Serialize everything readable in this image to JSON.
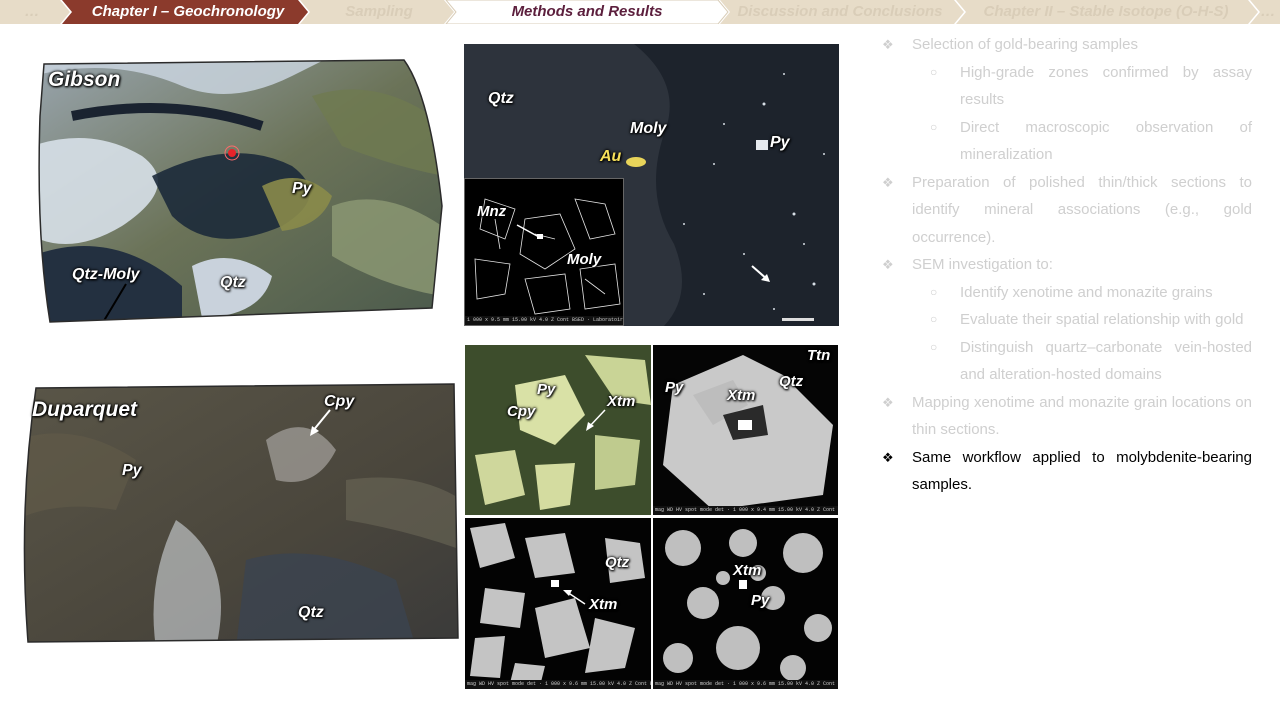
{
  "nav": {
    "items": [
      {
        "label": "…",
        "state": "past"
      },
      {
        "label": "Chapter I – Geochronology",
        "state": "current-chapter"
      },
      {
        "label": "Sampling",
        "state": "past"
      },
      {
        "label": "Methods and Results",
        "state": "active"
      },
      {
        "label": "Discussion and Conclusions",
        "state": "upcoming"
      },
      {
        "label": "Chapter II – Stable Isotope (O-H-S)",
        "state": "upcoming"
      },
      {
        "label": "…",
        "state": "upcoming"
      }
    ],
    "colors": {
      "chapter_fill": "#8b3a2c",
      "tab_fill": "#e7dcc8",
      "active_fill": "#ffffff",
      "active_text": "#5c1f3d"
    }
  },
  "gibson": {
    "title": "Gibson",
    "labels": {
      "py": "Py",
      "qtz_moly": "Qtz-Moly",
      "qtz": "Qtz"
    }
  },
  "gibson_micro": {
    "labels": {
      "qtz": "Qtz",
      "moly": "Moly",
      "au": "Au",
      "py": "Py"
    },
    "inset_labels": {
      "mnz": "Mnz",
      "moly": "Moly"
    }
  },
  "duparquet": {
    "title": "Duparquet",
    "labels": {
      "cpy": "Cpy",
      "py": "Py",
      "qtz": "Qtz"
    }
  },
  "duparquet_micro": {
    "tl": {
      "py": "Py",
      "cpy": "Cpy",
      "xtm": "Xtm"
    },
    "tr": {
      "ttn": "Ttn",
      "py": "Py",
      "xtm": "Xtm",
      "qtz": "Qtz"
    },
    "bl": {
      "qtz": "Qtz",
      "xtm": "Xtm"
    },
    "br": {
      "xtm": "Xtm",
      "py": "Py"
    }
  },
  "bullets": {
    "items": [
      {
        "level": 1,
        "text": "Selection of gold-bearing samples",
        "active": false
      },
      {
        "level": 2,
        "text": "High-grade zones confirmed by assay results",
        "active": false
      },
      {
        "level": 2,
        "text": "Direct macroscopic observation of mineralization",
        "active": false
      },
      {
        "level": 1,
        "text": "Preparation of polished thin/thick sections to identify mineral associations (e.g., gold occurrence).",
        "active": false
      },
      {
        "level": 1,
        "text": "SEM investigation to:",
        "active": false
      },
      {
        "level": 2,
        "text": "Identify xenotime and monazite grains",
        "active": false
      },
      {
        "level": 2,
        "text": "Evaluate their spatial relationship with gold",
        "active": false
      },
      {
        "level": 2,
        "text": "Distinguish quartz–carbonate vein-hosted and alteration-hosted domains",
        "active": false
      },
      {
        "level": 1,
        "text": "Mapping xenotime and monazite grain locations on thin sections.",
        "active": false
      },
      {
        "level": 1,
        "text": "Same workflow applied to molybdenite-bearing samples.",
        "active": true
      }
    ],
    "markers": {
      "l1": "❖",
      "l2": "○"
    },
    "colors": {
      "dim_text": "#cfcfcf",
      "active_text": "#000000"
    }
  }
}
